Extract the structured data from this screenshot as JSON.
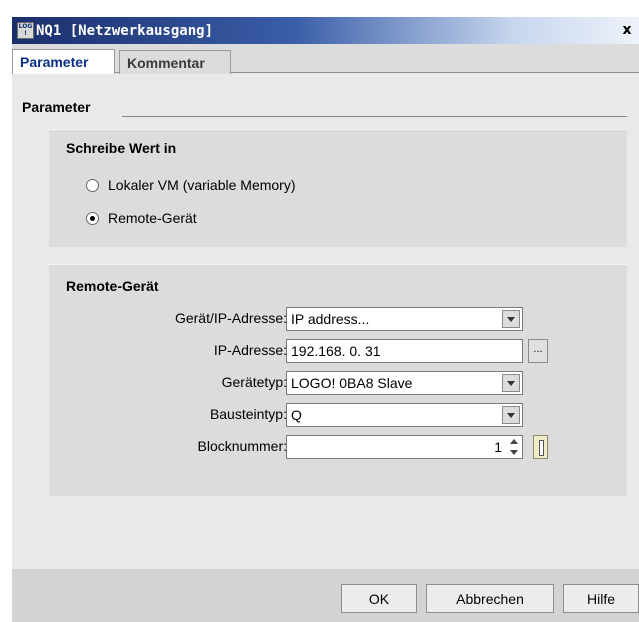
{
  "window": {
    "title": "NQ1 [Netzwerkausgang]",
    "icon_text_1": "LOG",
    "icon_text_2": "!",
    "close_label": "x"
  },
  "tabs": [
    {
      "label": "Parameter",
      "active": true
    },
    {
      "label": "Kommentar",
      "active": false
    }
  ],
  "parameter_section": {
    "title": "Parameter"
  },
  "write_value_group": {
    "title": "Schreibe Wert in",
    "options": [
      {
        "label": "Lokaler VM (variable Memory)",
        "checked": false
      },
      {
        "label": "Remote-Gerät",
        "checked": true
      }
    ]
  },
  "remote_group": {
    "title": "Remote-Gerät",
    "device_ip_label": "Gerät/IP-Adresse:",
    "device_ip_value": "IP address...",
    "ip_label": "IP-Adresse:",
    "ip_value": "192.168.  0. 31",
    "ip_button": "...",
    "device_type_label": "Gerätetyp:",
    "device_type_value": "LOGO! 0BA8 Slave",
    "block_type_label": "Bausteintyp:",
    "block_type_value": "Q",
    "block_number_label": "Blocknummer:",
    "block_number_value": "1"
  },
  "footer": {
    "ok": "OK",
    "cancel": "Abbrechen",
    "help": "Hilfe"
  }
}
